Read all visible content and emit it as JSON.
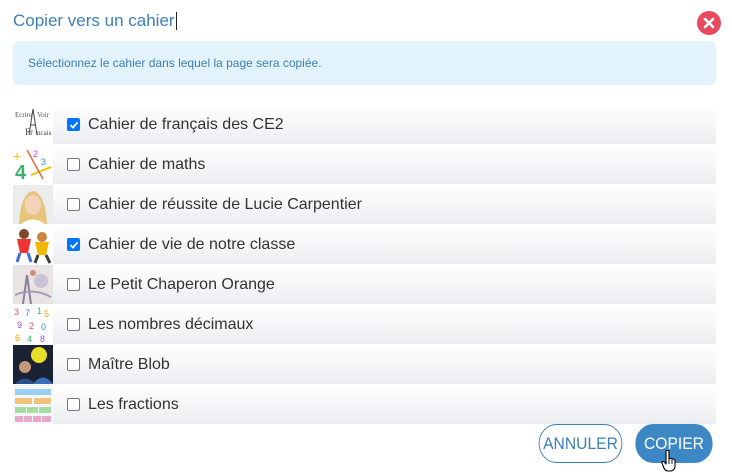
{
  "dialog": {
    "title": "Copier vers un cahier",
    "info": "Sélectionnez le cahier dans lequel la page sera copiée."
  },
  "notebooks": [
    {
      "label": "Cahier de français des CE2",
      "checked": true,
      "thumb": "francais-thumbnail"
    },
    {
      "label": "Cahier de maths",
      "checked": false,
      "thumb": "maths-thumbnail"
    },
    {
      "label": "Cahier de réussite de Lucie Carpentier",
      "checked": false,
      "thumb": "portrait-thumbnail"
    },
    {
      "label": "Cahier de vie de notre classe",
      "checked": true,
      "thumb": "children-thumbnail"
    },
    {
      "label": "Le Petit Chaperon Orange",
      "checked": false,
      "thumb": "illustration-thumbnail"
    },
    {
      "label": "Les nombres décimaux",
      "checked": false,
      "thumb": "numbers-thumbnail"
    },
    {
      "label": "Maître Blob",
      "checked": false,
      "thumb": "blob-thumbnail"
    },
    {
      "label": "Les fractions",
      "checked": false,
      "thumb": "fractions-thumbnail"
    }
  ],
  "buttons": {
    "cancel": "ANNULER",
    "copy": "COPIER"
  },
  "colors": {
    "accent": "#3d7fb5",
    "close": "#e84a5f",
    "info_bg": "#e3f3fb",
    "checkbox": "#0075ff"
  }
}
